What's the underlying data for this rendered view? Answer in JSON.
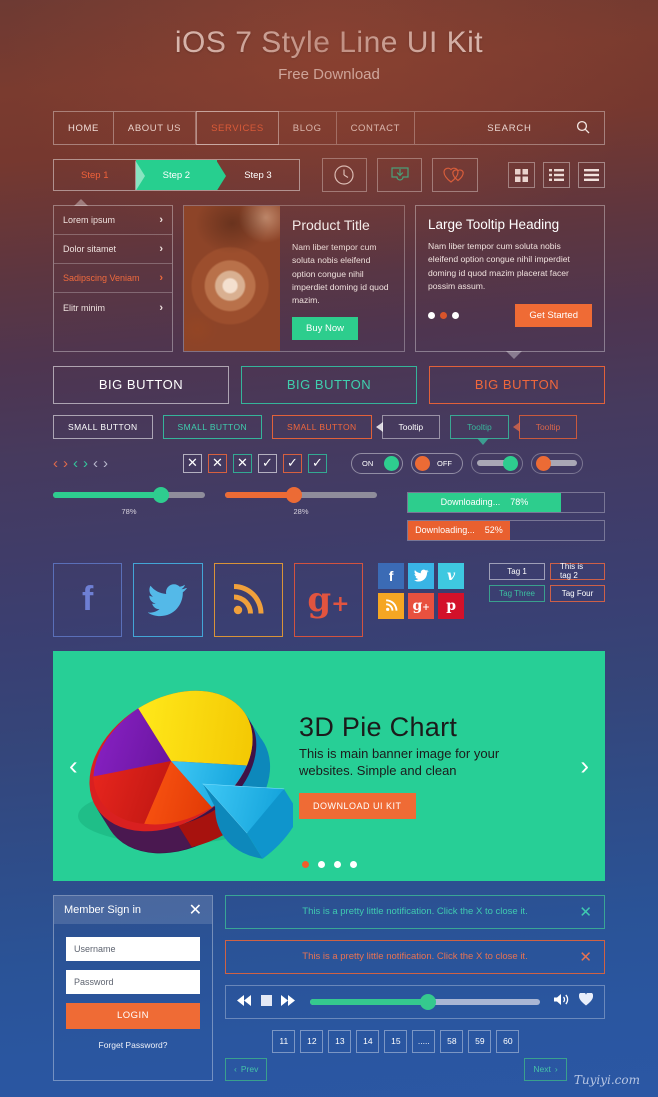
{
  "hero": {
    "title": "iOS 7 Style Line UI Kit",
    "subtitle": "Free Download"
  },
  "nav": {
    "items": [
      "HOME",
      "ABOUT US",
      "SERVICES",
      "BLOG",
      "CONTACT"
    ],
    "active": "SERVICES",
    "search_label": "SEARCH",
    "search_icon": "search-icon"
  },
  "steps": {
    "items": [
      "Step 1",
      "Step 2",
      "Step 3"
    ],
    "active_index": 1
  },
  "toolbar_icons": [
    "clock-icon",
    "download-inbox-icon",
    "hearts-icon"
  ],
  "view_icons": [
    "grid-view-icon",
    "list-view-icon",
    "menu-view-icon"
  ],
  "menu_card": {
    "items": [
      "Lorem ipsum",
      "Dolor sitamet",
      "Sadipscing Veniam",
      "Elitr minim"
    ],
    "active_index": 2
  },
  "product": {
    "title": "Product Title",
    "body": "Nam liber tempor cum soluta nobis eleifend option congue nihil imperdiet doming id quod mazim.",
    "button": "Buy Now"
  },
  "tooltip_card": {
    "title": "Large Tooltip Heading",
    "body": "Nam liber tempor cum soluta nobis eleifend option congue nihil imperdiet doming id quod mazim placerat facer possim assum.",
    "button": "Get Started",
    "dots": 3,
    "active_dot": 1
  },
  "big_buttons": [
    "BIG BUTTON",
    "BIG BUTTON",
    "BIG BUTTON"
  ],
  "small_buttons": [
    "SMALL BUTTON",
    "SMALL BUTTON",
    "SMALL BUTTON"
  ],
  "tooltips": [
    "Tooltip",
    "Tooltip",
    "Tooltip"
  ],
  "switches": {
    "on_label": "ON",
    "off_label": "OFF"
  },
  "sliders": [
    {
      "value": 78,
      "label": "78%",
      "color": "#2ecd8f"
    },
    {
      "value": 28,
      "label": "28%",
      "color": "#ec6b35"
    }
  ],
  "progress": [
    {
      "label": "Downloading...",
      "value": "78%",
      "percent": 78,
      "color": "#2dcd8d"
    },
    {
      "label": "Downloading...",
      "value": "52%",
      "percent": 52,
      "color": "#e9602f"
    }
  ],
  "social_large": [
    "facebook-icon",
    "twitter-icon",
    "rss-icon",
    "googleplus-icon"
  ],
  "social_large_glyphs": [
    "f",
    "🐦",
    "◜",
    "g+"
  ],
  "social_mini": [
    {
      "name": "facebook-icon",
      "glyph": "f",
      "color": "#3b6bb5"
    },
    {
      "name": "twitter-icon",
      "glyph": "🐦",
      "color": "#39b4e5"
    },
    {
      "name": "vimeo-icon",
      "glyph": "v",
      "color": "#3ec8e0"
    },
    {
      "name": "rss-icon",
      "glyph": "◜",
      "color": "#f5a623"
    },
    {
      "name": "googleplus-icon",
      "glyph": "g+",
      "color": "#e8513f"
    },
    {
      "name": "pinterest-icon",
      "glyph": "p",
      "color": "#d3112a"
    }
  ],
  "tags": [
    "Tag 1",
    "This is tag 2",
    "Tag Three",
    "Tag Four"
  ],
  "banner": {
    "title": "3D Pie Chart",
    "body": "This is main banner image for your websites. Simple and clean",
    "button": "DOWNLOAD UI KIT",
    "dots": 4,
    "active_dot": 0,
    "prev_icon": "chevron-left-icon",
    "next_icon": "chevron-right-icon"
  },
  "chart_data": {
    "type": "pie",
    "title": "3D Pie Chart",
    "categories": [
      "Cyan",
      "Yellow",
      "Purple",
      "Orange",
      "Red"
    ],
    "values": [
      30,
      17,
      20,
      13,
      20
    ],
    "colors": [
      "#25b7e8",
      "#f7dd1c",
      "#8a2ac0",
      "#f04a18",
      "#d92020"
    ],
    "legend": "none",
    "exploded": [
      "Cyan"
    ]
  },
  "login": {
    "title": "Member Sign in",
    "close_icon": "close-icon",
    "username_placeholder": "Username",
    "password_placeholder": "Password",
    "button": "LOGIN",
    "forget": "Forget Password?"
  },
  "notifications": [
    {
      "text": "This is a pretty little notification. Click the X to close it.",
      "style": "teal"
    },
    {
      "text": "This is a pretty little notification. Click the X to close it.",
      "style": "orange"
    }
  ],
  "player": {
    "prev_icon": "rewind-icon",
    "stop_icon": "stop-icon",
    "next_icon": "fastforward-icon",
    "volume_icon": "volume-icon",
    "heart_icon": "heart-icon",
    "progress_percent": 50
  },
  "pagination": {
    "prev": "Prev",
    "next": "Next",
    "pages": [
      "11",
      "12",
      "13",
      "14",
      "15",
      ".....",
      "58",
      "59",
      "60"
    ]
  },
  "watermark": "Tuyiyi.com"
}
